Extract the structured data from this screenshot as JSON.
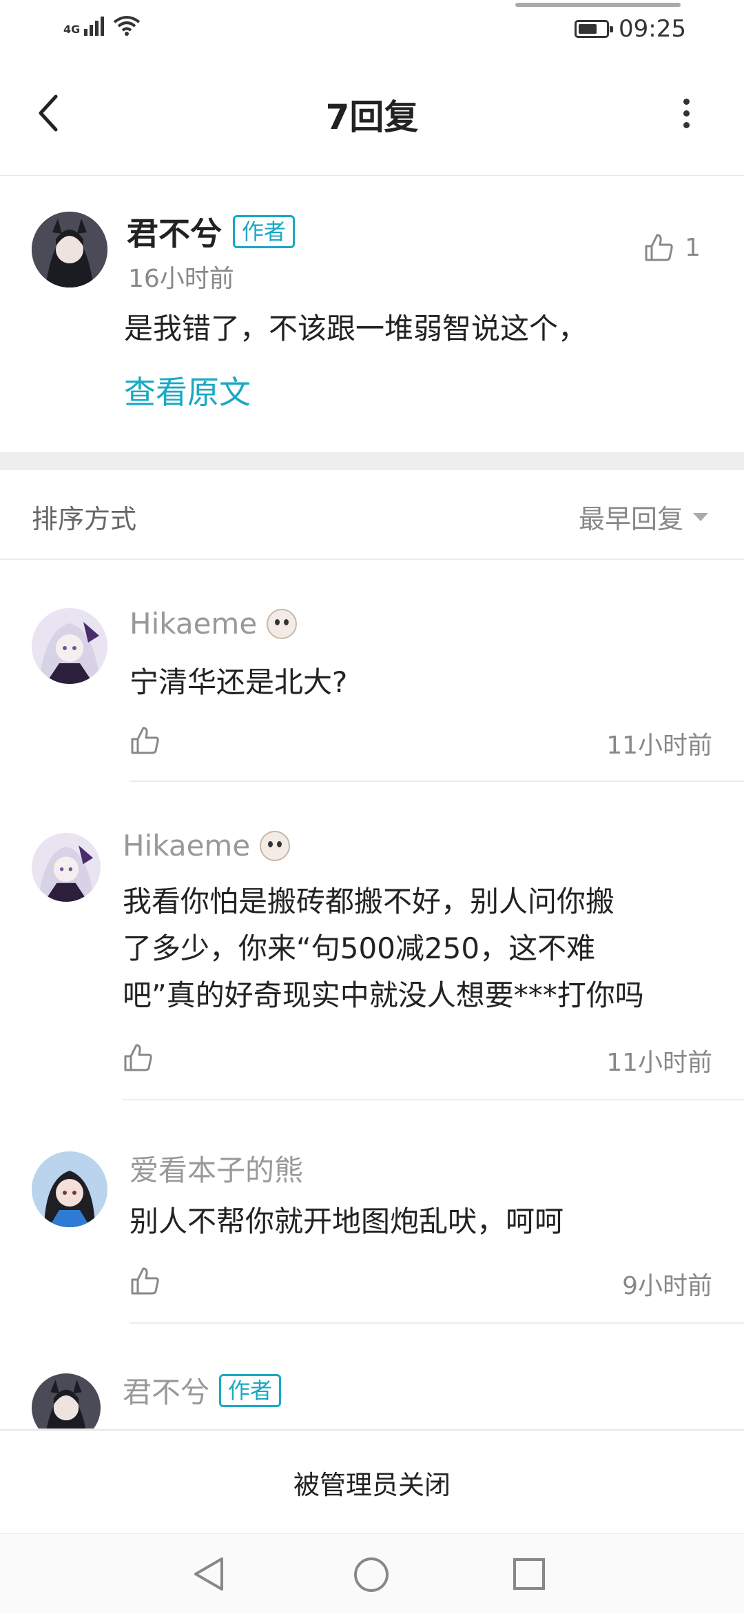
{
  "status_bar": {
    "network": "4G",
    "time": "09:25"
  },
  "header": {
    "title": "7回复"
  },
  "main_post": {
    "author": "君不兮",
    "badge": "作者",
    "time": "16小时前",
    "like_count": "1",
    "text": "是我错了，不该跟一堆弱智说这个，",
    "view_original": "查看原文"
  },
  "sort": {
    "label": "排序方式",
    "value": "最早回复"
  },
  "replies": [
    {
      "author": "Hikaeme",
      "text": "宁清华还是北大?",
      "time": "11小时前"
    },
    {
      "author": "Hikaeme",
      "text_lines": [
        "我看你怕是搬砖都搬不好，别人问你搬",
        "了多少，你来“句500减250，这不难",
        "吧”真的好奇现实中就没人想要***打你吗"
      ],
      "time": "11小时前"
    },
    {
      "author": "爱看本子的熊",
      "text": "别人不帮你就开地图炮乱吠，呵呵",
      "time": "9小时前"
    },
    {
      "author": "君不兮",
      "badge": "作者"
    }
  ],
  "footer": {
    "closed_text": "被管理员关闭"
  },
  "colors": {
    "accent": "#19a9c3",
    "gray_text": "#888888",
    "divider": "#eeeeee"
  },
  "icons": [
    "back-icon",
    "more-icon",
    "thumb-up-icon",
    "sort-caret-icon",
    "nav-back-icon",
    "nav-home-icon",
    "nav-recents-icon"
  ]
}
